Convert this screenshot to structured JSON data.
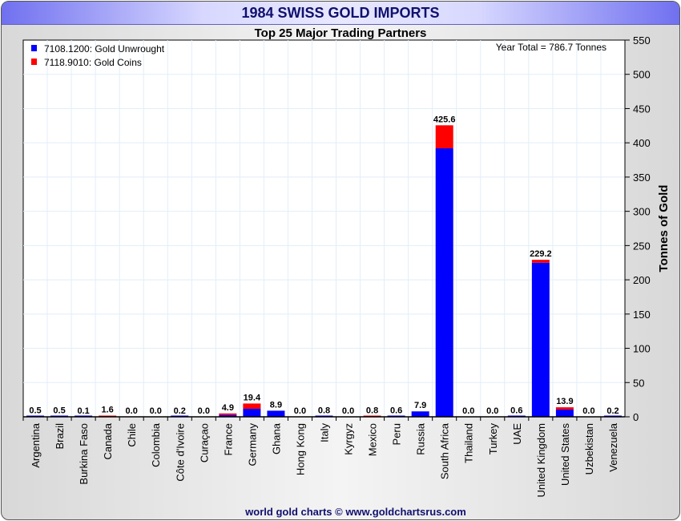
{
  "chart_data": {
    "type": "bar",
    "stacked": true,
    "title": "1984 SWISS GOLD IMPORTS",
    "subtitle": "Top 25 Major Trading Partners",
    "ylabel": "Tonnes of Gold",
    "ylim": [
      0,
      550
    ],
    "yticks": [
      0,
      50,
      100,
      150,
      200,
      250,
      300,
      350,
      400,
      450,
      500,
      550
    ],
    "annotation": "Year Total = 786.7 Tonnes",
    "footer": "world gold charts © www.goldchartsrus.com",
    "legend_position": "top-left",
    "categories": [
      "Argentina",
      "Brazil",
      "Burkina Faso",
      "Canada",
      "Chile",
      "Colombia",
      "Côte d'Ivoire",
      "Curaçao",
      "France",
      "Germany",
      "Ghana",
      "Hong Kong",
      "Italy",
      "Kyrgyz",
      "Mexico",
      "Peru",
      "Russia",
      "South Africa",
      "Thailand",
      "Turkey",
      "UAE",
      "United Kingdom",
      "United States",
      "Uzbekistan",
      "Venezuela"
    ],
    "total_labels": [
      "0.5",
      "0.5",
      "0.1",
      "1.6",
      "0.0",
      "0.0",
      "0.2",
      "0.0",
      "4.9",
      "19.4",
      "8.9",
      "0.0",
      "0.8",
      "0.0",
      "0.8",
      "0.6",
      "7.9",
      "425.6",
      "0.0",
      "0.0",
      "0.6",
      "229.2",
      "13.9",
      "0.0",
      "0.2"
    ],
    "series": [
      {
        "name": "7108.1200: Gold Unwrought",
        "color": "#0000ff",
        "values": [
          0.5,
          0.5,
          0.1,
          0,
          0,
          0,
          0.2,
          0,
          2.7,
          11.7,
          8.9,
          0,
          0.8,
          0,
          0,
          0.6,
          7.9,
          392.0,
          0,
          0,
          0.6,
          225.0,
          10.5,
          0,
          0.2
        ]
      },
      {
        "name": "7118.9010: Gold Coins",
        "color": "#ff0000",
        "values": [
          0,
          0,
          0,
          1.6,
          0,
          0,
          0,
          0,
          2.2,
          7.7,
          0,
          0,
          0,
          0,
          0.8,
          0,
          0,
          33.6,
          0,
          0,
          0,
          4.2,
          3.4,
          0,
          0
        ]
      }
    ]
  }
}
